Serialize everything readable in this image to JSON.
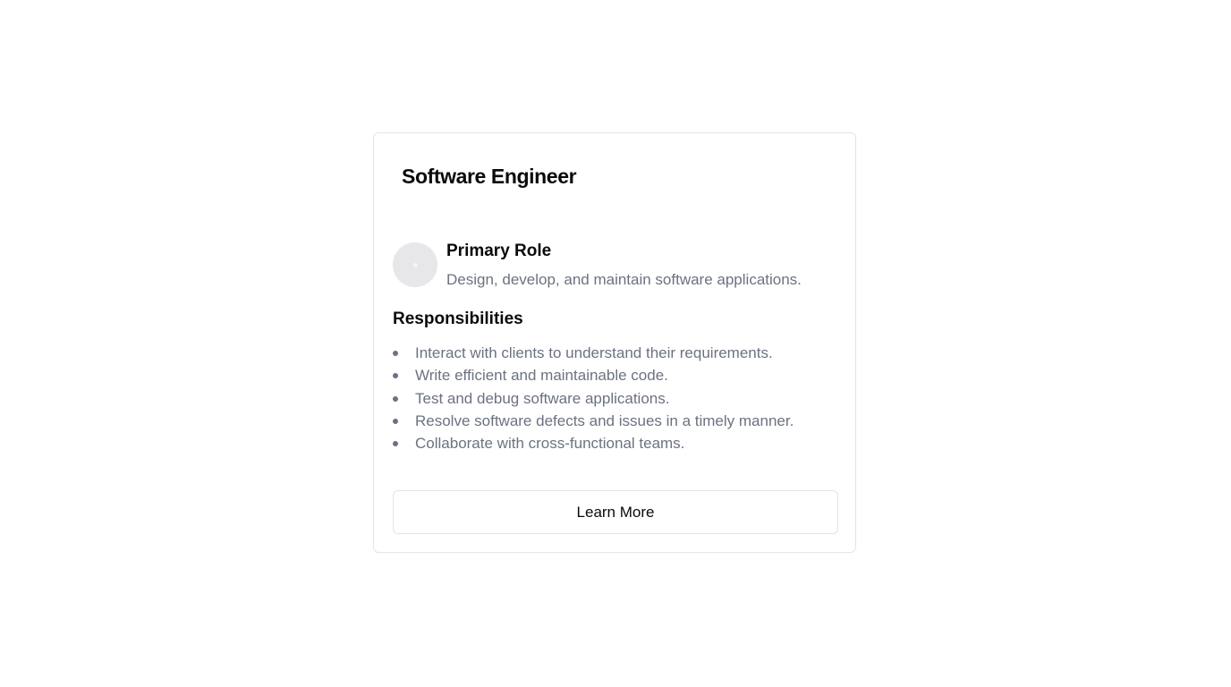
{
  "card": {
    "title": "Software Engineer",
    "primary_role": {
      "heading": "Primary Role",
      "description": "Design, develop, and maintain software applications.",
      "avatar_icon": "placeholder-image-icon"
    },
    "responsibilities": {
      "heading": "Responsibilities",
      "items": [
        "Interact with clients to understand their requirements.",
        "Write efficient and maintainable code.",
        "Test and debug software applications.",
        "Resolve software defects and issues in a timely manner.",
        "Collaborate with cross-functional teams."
      ]
    },
    "button_label": "Learn More"
  },
  "colors": {
    "muted_text": "#6b7280",
    "border": "#e4e4e7",
    "avatar_bg": "#e7e7e9"
  }
}
